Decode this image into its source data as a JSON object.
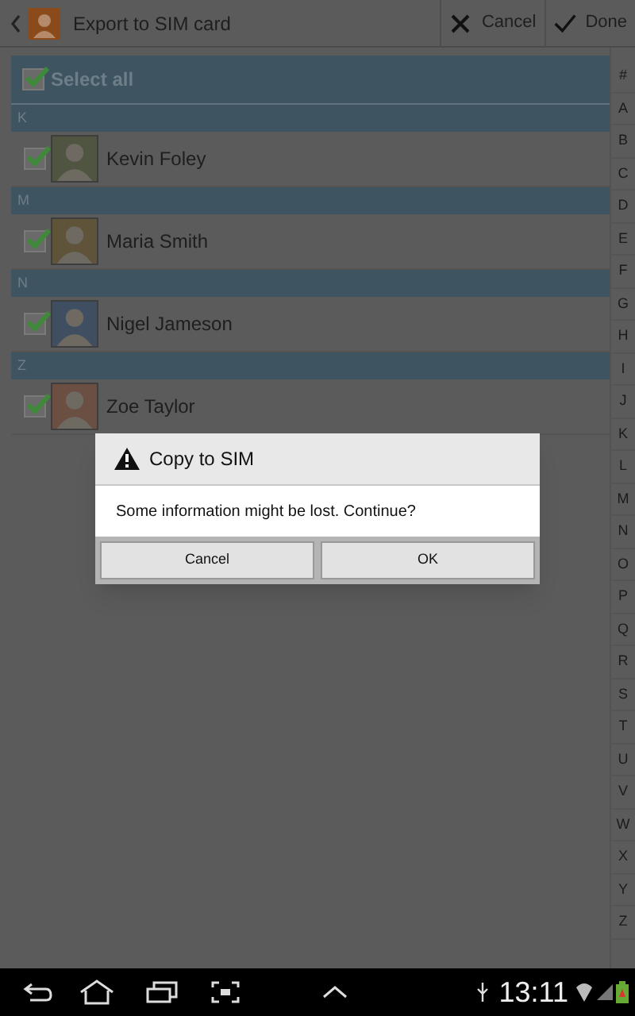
{
  "action_bar": {
    "title": "Export to SIM card",
    "actions": [
      {
        "kind": "cancel",
        "label": "Cancel"
      },
      {
        "kind": "done",
        "label": "Done"
      }
    ]
  },
  "select_all": {
    "label": "Select all",
    "checked": true
  },
  "sections": [
    {
      "letter": "K",
      "contacts": [
        {
          "name": "Kevin Foley",
          "checked": true,
          "color": "#4f5541"
        }
      ]
    },
    {
      "letter": "M",
      "contacts": [
        {
          "name": "Maria Smith",
          "checked": true,
          "color": "#5f5339"
        }
      ]
    },
    {
      "letter": "N",
      "contacts": [
        {
          "name": "Nigel Jameson",
          "checked": true,
          "color": "#3f4f61"
        }
      ]
    },
    {
      "letter": "Z",
      "contacts": [
        {
          "name": "Zoe Taylor",
          "checked": true,
          "color": "#6a4f42"
        }
      ]
    }
  ],
  "index": [
    "#",
    "A",
    "B",
    "C",
    "D",
    "E",
    "F",
    "G",
    "H",
    "I",
    "J",
    "K",
    "L",
    "M",
    "N",
    "O",
    "P",
    "Q",
    "R",
    "S",
    "T",
    "U",
    "V",
    "W",
    "X",
    "Y",
    "Z"
  ],
  "dialog": {
    "title": "Copy to SIM",
    "message": "Some information might be lost. Continue?",
    "buttons": [
      "Cancel",
      "OK"
    ]
  },
  "status_bar": {
    "time": "13:11"
  }
}
